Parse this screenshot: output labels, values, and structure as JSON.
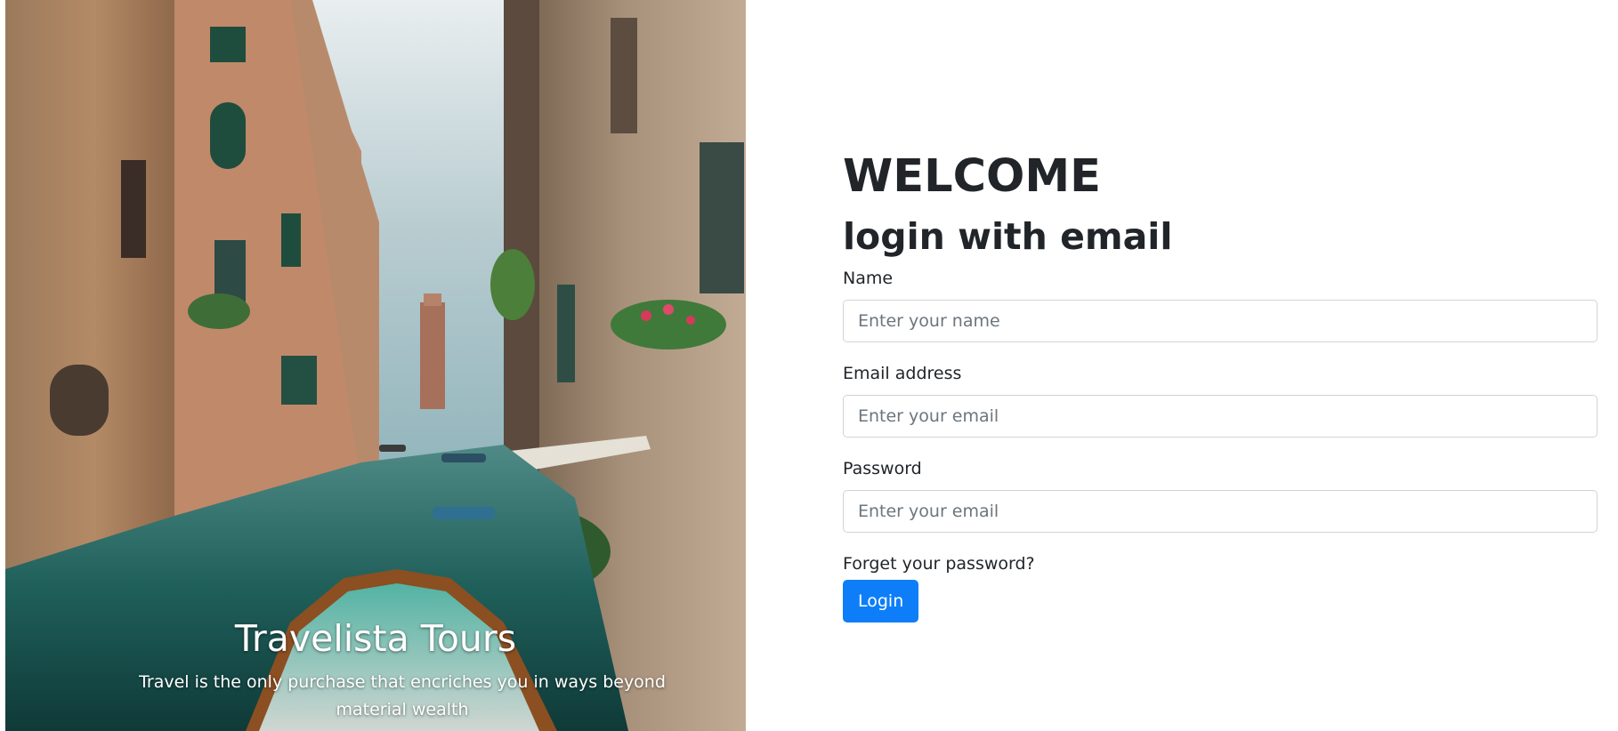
{
  "hero": {
    "title": "Travelista Tours",
    "tagline": "Travel is the only purchase that encriches you in ways beyond material wealth",
    "image": "venice-canal-photo"
  },
  "login": {
    "welcome": "WELCOME",
    "subtitle": "login with email",
    "fields": [
      {
        "label": "Name",
        "placeholder": "Enter your name"
      },
      {
        "label": "Email address",
        "placeholder": "Enter your email"
      },
      {
        "label": "Password",
        "placeholder": "Enter your email"
      }
    ],
    "forgot_link": "Forget your password?",
    "submit_label": "Login"
  },
  "colors": {
    "primary": "#0d7ef8",
    "text": "#212529",
    "input_border": "#ced4da",
    "placeholder": "#6c757d"
  }
}
